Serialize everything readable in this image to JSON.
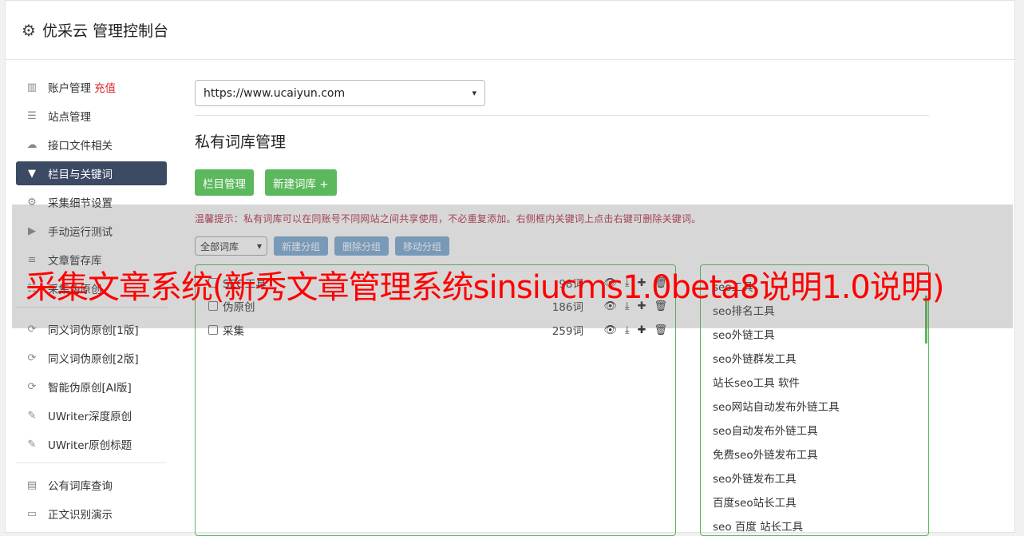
{
  "header": {
    "title": "优采云 管理控制台",
    "icon": "gear-icon"
  },
  "sidebar": {
    "group1": [
      {
        "label": "账户管理",
        "extra": "充值",
        "icon": "bar-chart-icon"
      },
      {
        "label": "站点管理",
        "icon": "server-icon"
      },
      {
        "label": "接口文件相关",
        "icon": "cloud-upload-icon"
      },
      {
        "label": "栏目与关键词",
        "icon": "filter-icon",
        "active": true
      },
      {
        "label": "采集细节设置",
        "icon": "gears-icon"
      },
      {
        "label": "手动运行测试",
        "icon": "play-circle-icon"
      },
      {
        "label": "文章暂存库",
        "icon": "database-icon"
      },
      {
        "label": "采集伪原创",
        "icon": "list-icon"
      }
    ],
    "group2": [
      {
        "label": "同义词伪原创[1版]",
        "icon": "refresh-icon"
      },
      {
        "label": "同义词伪原创[2版]",
        "icon": "refresh-icon"
      },
      {
        "label": "智能伪原创[AI版]",
        "icon": "refresh-icon"
      },
      {
        "label": "UWriter深度原创",
        "icon": "edit-icon"
      },
      {
        "label": "UWriter原创标题",
        "icon": "edit-icon"
      }
    ],
    "group3": [
      {
        "label": "公有词库查询",
        "icon": "book-icon"
      },
      {
        "label": "正文识别演示",
        "icon": "monitor-icon"
      }
    ]
  },
  "main": {
    "site_select": "https://www.ucaiyun.com",
    "section_title": "私有词库管理",
    "buttons": {
      "column_manage": "栏目管理",
      "new_lib": "新建词库 +"
    },
    "tip": "温馨提示：私有词库可以在同账号不同网站之间共享使用，不必重复添加。右侧框内关键词上点击右键可删除关键词。",
    "filter_select": "全部词库",
    "group_buttons": {
      "new_group": "新建分组",
      "delete_group": "删除分组",
      "move_group": "移动分组"
    },
    "libraries": [
      {
        "name": "SEO工具",
        "count": "98词"
      },
      {
        "name": "伪原创",
        "count": "186词"
      },
      {
        "name": "采集",
        "count": "259词"
      }
    ],
    "keywords": [
      "seo工具",
      "seo排名工具",
      "seo外链工具",
      "seo外链群发工具",
      "站长seo工具 软件",
      "seo网站自动发布外链工具",
      "seo自动发布外链工具",
      "免费seo外链发布工具",
      "seo外链发布工具",
      "百度seo站长工具",
      "seo 百度 站长工具"
    ]
  },
  "overlay": {
    "text": "采集文章系统(新秀文章管理系统sinsiucms1.0beta8说明1.0说明)"
  }
}
